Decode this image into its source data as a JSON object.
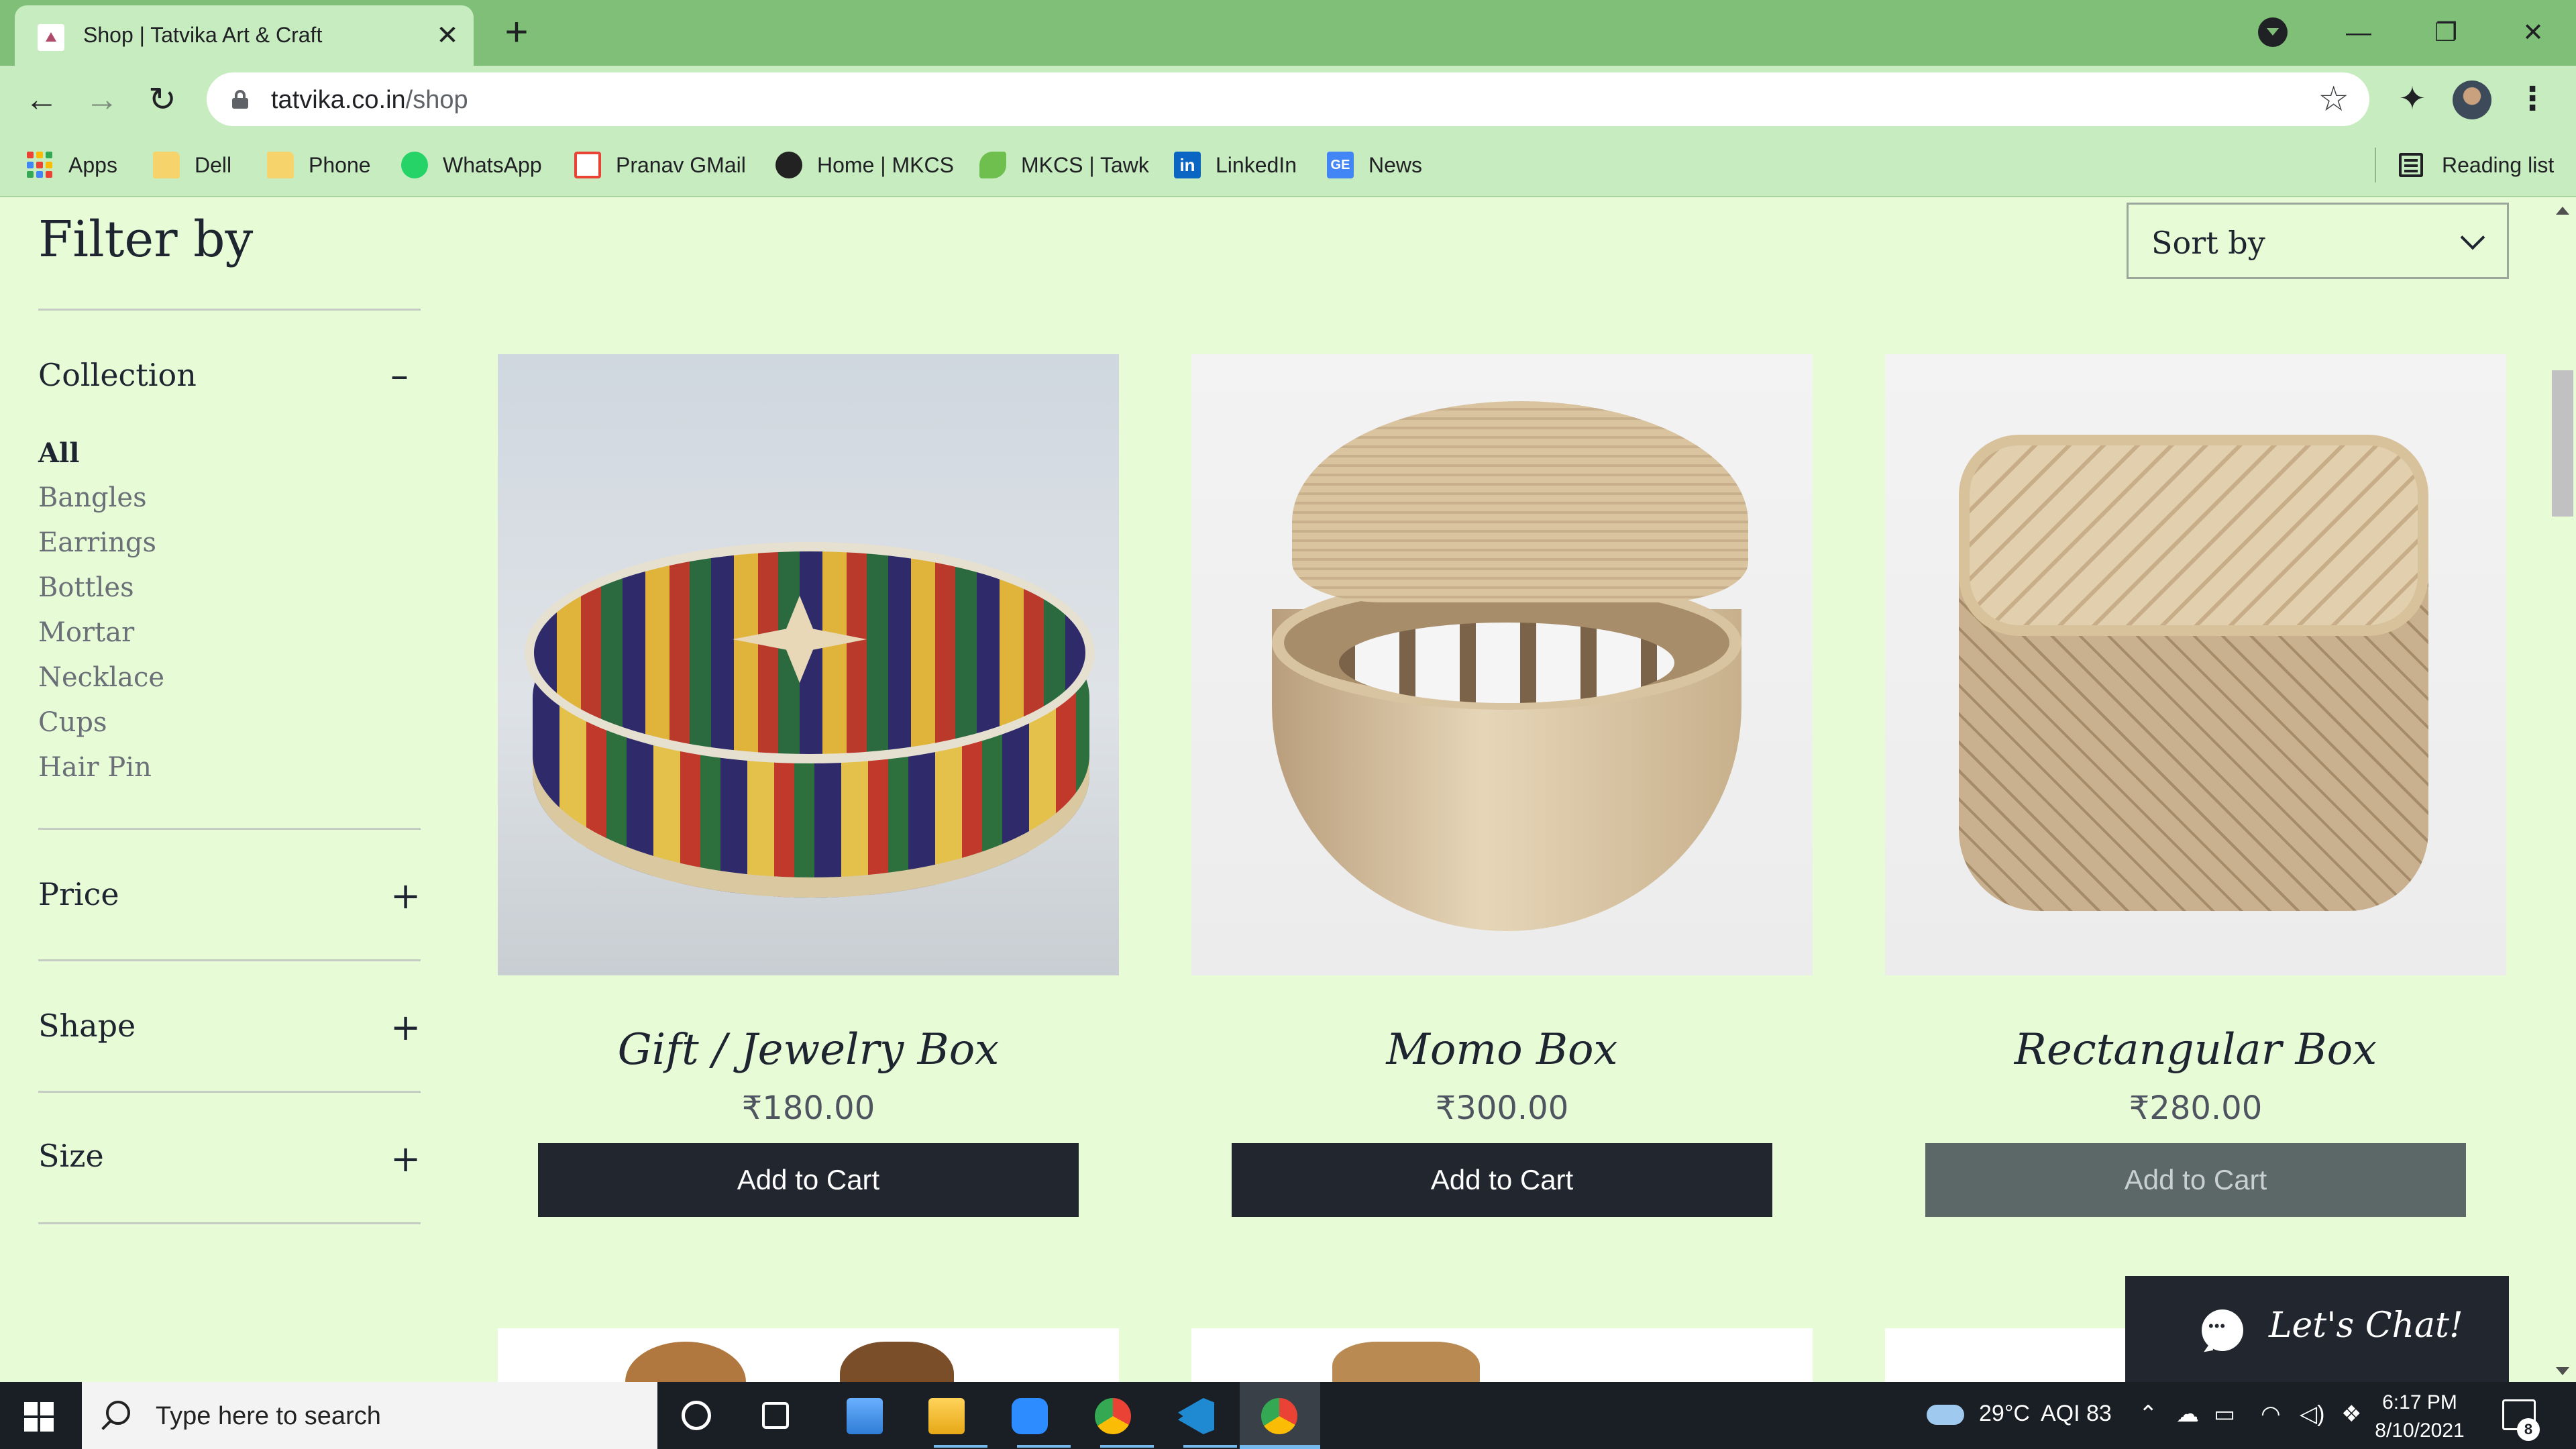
{
  "browser": {
    "tab_title": "Shop | Tatvika Art & Craft",
    "tab_close": "✕",
    "new_tab": "+",
    "url_domain": "tatvika.co.in",
    "url_path": "/shop",
    "window_minimize": "—",
    "window_restore": "❐",
    "window_close": "✕"
  },
  "nav": {
    "back": "←",
    "forward": "→",
    "reload": "↻",
    "star": "☆",
    "extensions": "✦",
    "menu": "⋮"
  },
  "bookmarks": [
    {
      "label": "Apps",
      "icon": "apps-grid-icon"
    },
    {
      "label": "Dell",
      "icon": "folder-icon"
    },
    {
      "label": "Phone",
      "icon": "folder-icon"
    },
    {
      "label": "WhatsApp",
      "icon": "whatsapp-icon"
    },
    {
      "label": "Pranav GMail",
      "icon": "gmail-icon"
    },
    {
      "label": "Home | MKCS",
      "icon": "mkcs-icon"
    },
    {
      "label": "MKCS | Tawk",
      "icon": "tawk-icon"
    },
    {
      "label": "LinkedIn",
      "icon": "linkedin-icon"
    },
    {
      "label": "News",
      "icon": "google-news-icon"
    }
  ],
  "reading_list": "Reading list",
  "filter": {
    "title": "Filter by",
    "collection": {
      "label": "Collection",
      "toggle": "–",
      "items": [
        "All",
        "Bangles",
        "Earrings",
        "Bottles",
        "Mortar",
        "Necklace",
        "Cups",
        "Hair Pin"
      ],
      "selected": "All"
    },
    "price": {
      "label": "Price",
      "toggle": "+"
    },
    "shape": {
      "label": "Shape",
      "toggle": "+"
    },
    "size": {
      "label": "Size",
      "toggle": "+"
    }
  },
  "sort": {
    "label": "Sort by"
  },
  "products": [
    {
      "name": "Gift / Jewelry Box",
      "price": "₹180.00",
      "button": "Add to Cart"
    },
    {
      "name": "Momo Box",
      "price": "₹300.00",
      "button": "Add to Cart"
    },
    {
      "name": "Rectangular Box",
      "price": "₹280.00",
      "button": "Add to Cart"
    }
  ],
  "chat": {
    "label": "Let's Chat!"
  },
  "taskbar": {
    "search_placeholder": "Type here to search",
    "weather_temp": "29°C",
    "aqi": "AQI 83",
    "time": "6:17 PM",
    "date": "8/10/2021",
    "notification_count": "8"
  },
  "colors": {
    "titlebar": "#7fbf78",
    "page_bg": "#e6fbd6",
    "button_dark": "#22272f",
    "button_hover": "#5c6767"
  }
}
